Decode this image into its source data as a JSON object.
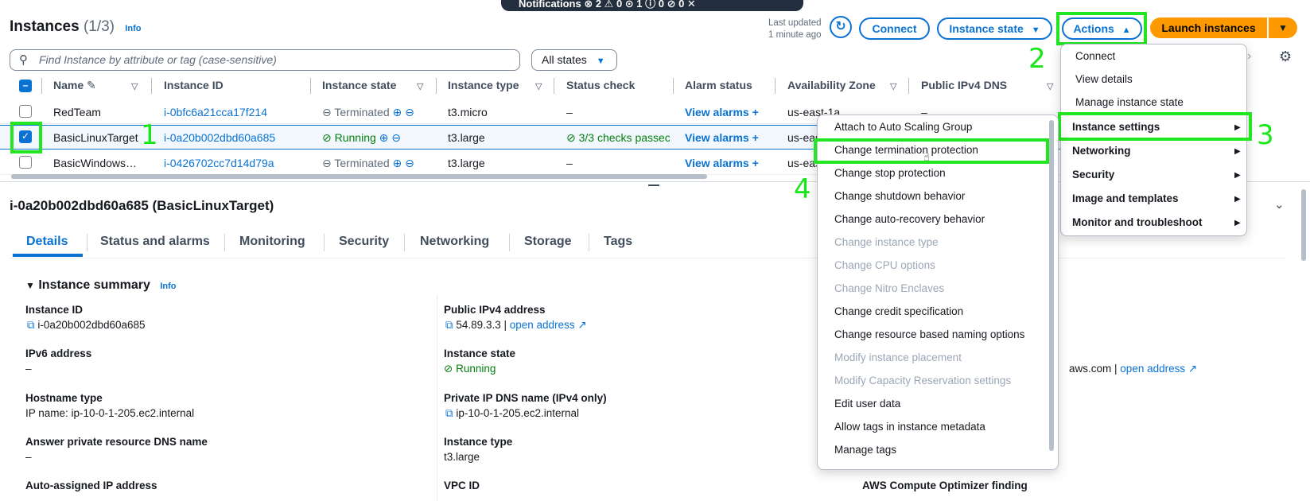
{
  "notification_bar": {
    "text": "Notifications  ⊗ 2  ⚠ 0  ⊙ 1  ⓘ 0  ⊘ 0   ✕"
  },
  "header": {
    "title": "Instances",
    "count": "(1/3)",
    "info": "Info",
    "last_updated_line1": "Last updated",
    "last_updated_line2": "1 minute ago",
    "refresh_icon": "refresh-icon",
    "connect": "Connect",
    "instance_state": "Instance state",
    "actions": "Actions",
    "launch": "Launch instances"
  },
  "filter": {
    "search_placeholder": "Find Instance by attribute or tag (case-sensitive)",
    "states": "All states"
  },
  "table": {
    "columns": [
      "Name",
      "Instance ID",
      "Instance state",
      "Instance type",
      "Status check",
      "Alarm status",
      "Availability Zone",
      "Public IPv4 DNS"
    ],
    "rows": [
      {
        "name": "RedTeam",
        "id": "i-0bfc6a21cca17f214",
        "state": "Terminated",
        "type": "t3.micro",
        "status": "–",
        "alarm": "View alarms",
        "az": "us-east-1a",
        "dns": "–"
      },
      {
        "name": "BasicLinuxTarget",
        "id": "i-0a20b002dbd60a685",
        "state": "Running",
        "type": "t3.large",
        "status": "3/3 checks passec",
        "alarm": "View alarms",
        "az": "us-eas",
        "dns": ""
      },
      {
        "name": "BasicWindows…",
        "id": "i-0426702cc7d14d79a",
        "state": "Terminated",
        "type": "t3.large",
        "status": "–",
        "alarm": "View alarms",
        "az": "us-eas",
        "dns": ""
      }
    ]
  },
  "detail": {
    "title": "i-0a20b002dbd60a685 (BasicLinuxTarget)",
    "tabs": [
      "Details",
      "Status and alarms",
      "Monitoring",
      "Security",
      "Networking",
      "Storage",
      "Tags"
    ],
    "section": "Instance summary",
    "section_info": "Info",
    "fields_left": [
      {
        "label": "Instance ID",
        "value": "i-0a20b002dbd60a685"
      },
      {
        "label": "IPv6 address",
        "value": "–"
      },
      {
        "label": "Hostname type",
        "value": "IP name: ip-10-0-1-205.ec2.internal"
      },
      {
        "label": "Answer private resource DNS name",
        "value": "–"
      },
      {
        "label": "Auto-assigned IP address",
        "value": ""
      }
    ],
    "fields_mid": [
      {
        "label": "Public IPv4 address",
        "value": "54.89.3.3 |",
        "link": "open address"
      },
      {
        "label": "Instance state",
        "value": "Running"
      },
      {
        "label": "Private IP DNS name (IPv4 only)",
        "value": "ip-10-0-1-205.ec2.internal"
      },
      {
        "label": "Instance type",
        "value": "t3.large"
      },
      {
        "label": "VPC ID",
        "value": ""
      }
    ],
    "right_partial": "aws.com |",
    "right_link": "open address",
    "optimizer_label": "AWS Compute Optimizer finding"
  },
  "actions_menu": {
    "items": [
      "Connect",
      "View details",
      "Manage instance state",
      "Instance settings",
      "Networking",
      "Security",
      "Image and templates",
      "Monitor and troubleshoot"
    ]
  },
  "settings_menu": {
    "items": [
      {
        "label": "Attach to Auto Scaling Group",
        "disabled": false
      },
      {
        "label": "Change termination protection",
        "disabled": false
      },
      {
        "label": "Change stop protection",
        "disabled": false
      },
      {
        "label": "Change shutdown behavior",
        "disabled": false
      },
      {
        "label": "Change auto-recovery behavior",
        "disabled": false
      },
      {
        "label": "Change instance type",
        "disabled": true
      },
      {
        "label": "Change CPU options",
        "disabled": true
      },
      {
        "label": "Change Nitro Enclaves",
        "disabled": true
      },
      {
        "label": "Change credit specification",
        "disabled": false
      },
      {
        "label": "Change resource based naming options",
        "disabled": false
      },
      {
        "label": "Modify instance placement",
        "disabled": true
      },
      {
        "label": "Modify Capacity Reservation settings",
        "disabled": true
      },
      {
        "label": "Edit user data",
        "disabled": false
      },
      {
        "label": "Allow tags in instance metadata",
        "disabled": false
      },
      {
        "label": "Manage tags",
        "disabled": false
      }
    ]
  },
  "annotations": [
    "1",
    "2",
    "3",
    "4"
  ],
  "colors": {
    "highlight": "#22e622",
    "link": "#0972d3",
    "accent": "#ff9900",
    "running": "#037f0c"
  }
}
